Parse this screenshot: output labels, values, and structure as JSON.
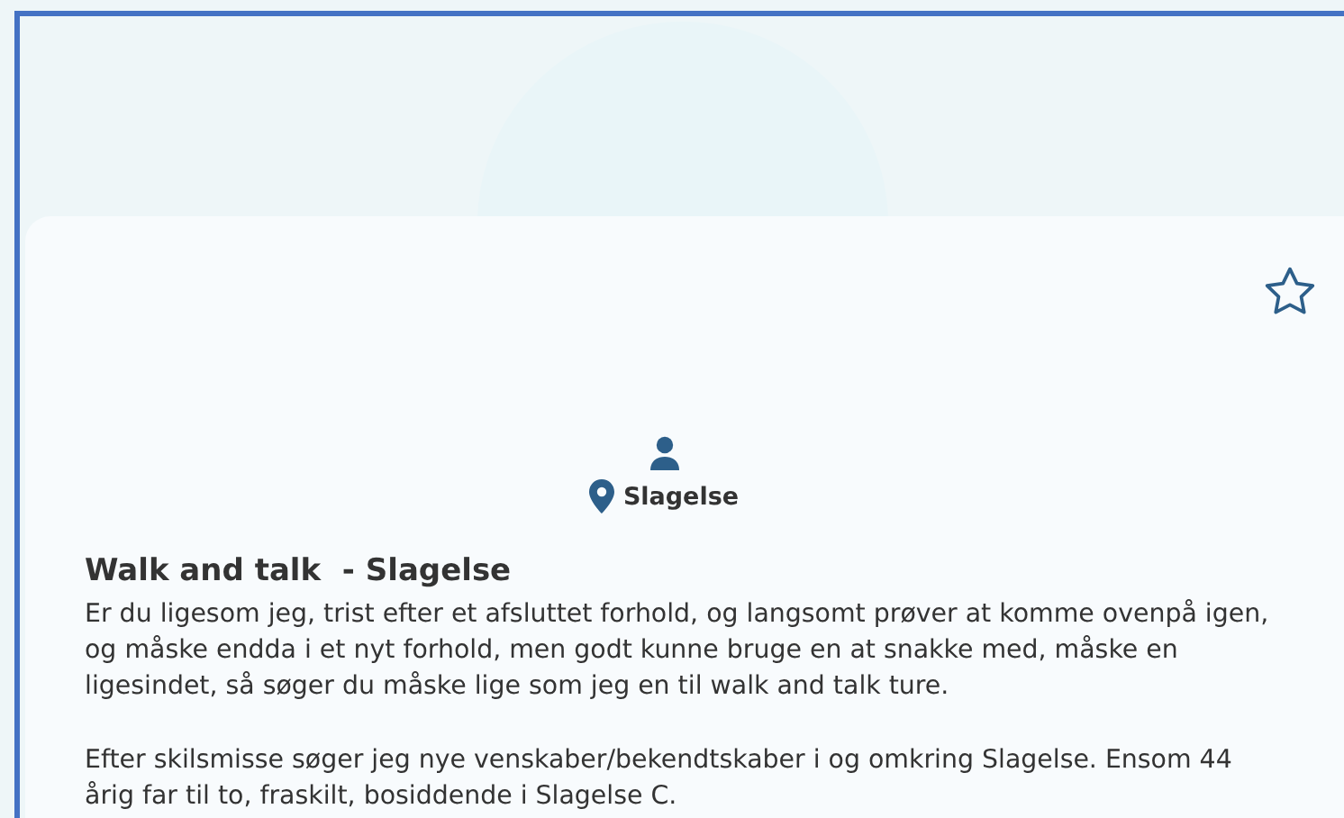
{
  "profile": {
    "favorite": false,
    "location": "Slagelse",
    "title": "Walk and talk  - Slagelse",
    "paragraphs": [
      "Er du ligesom jeg, trist efter et afsluttet forhold, og langsomt prøver at komme ovenpå igen, og måske endda i et nyt forhold, men godt kunne bruge en at snakke med, måske en ligesindet, så søger du måske lige som jeg en til walk and talk ture.",
      "Efter skilsmisse søger jeg nye venskaber/bekendtskaber i og omkring Slagelse. Ensom 44 årig far til to, fraskilt, bosiddende i Slagelse C."
    ]
  }
}
